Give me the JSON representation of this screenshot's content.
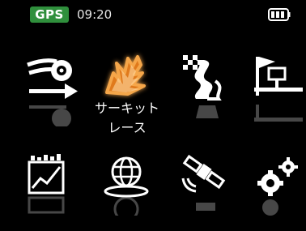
{
  "status": {
    "gps_label": "GPS",
    "time": "09:20",
    "battery_level": 1.0
  },
  "menu": {
    "selected_index": 1,
    "items": [
      {
        "icon": "speed-arrow-icon",
        "label": ""
      },
      {
        "icon": "circuit-race-icon",
        "label_line1": "サーキット",
        "label_line2": "レース"
      },
      {
        "icon": "road-finish-flag-icon",
        "label": ""
      },
      {
        "icon": "route-flag-icon",
        "label": ""
      },
      {
        "icon": "chart-icon",
        "label": ""
      },
      {
        "icon": "globe-icon",
        "label": ""
      },
      {
        "icon": "satellite-icon",
        "label": ""
      },
      {
        "icon": "settings-gears-icon",
        "label": ""
      }
    ]
  },
  "colors": {
    "background": "#000000",
    "gps_badge": "#2f8f3c",
    "selected_glow": "#f08a24",
    "icon": "#ffffff"
  }
}
